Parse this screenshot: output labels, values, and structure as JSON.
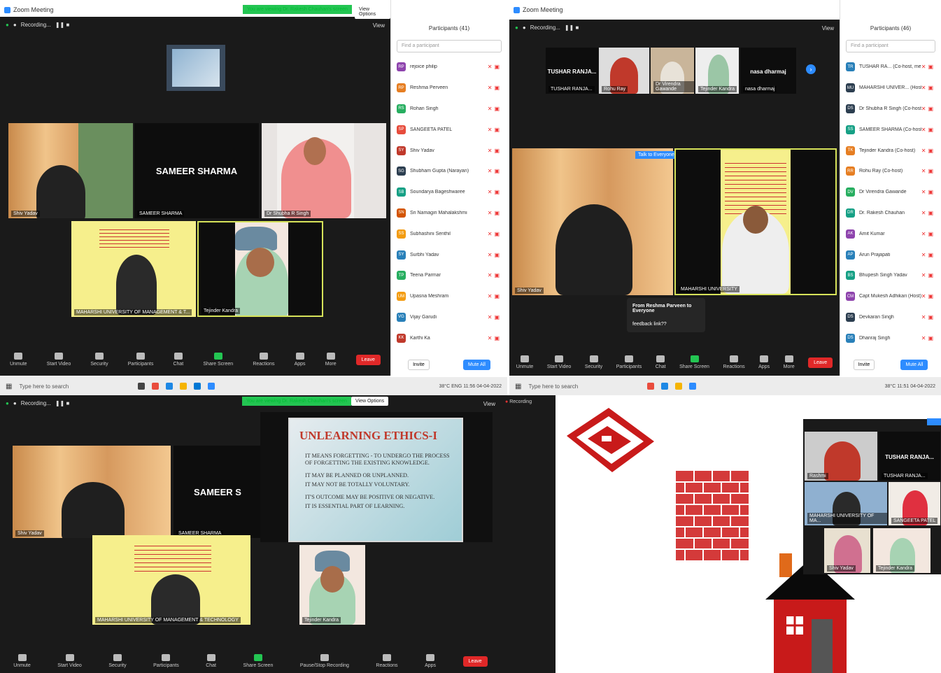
{
  "app": {
    "window_title": "Zoom Meeting",
    "recording_label": "Recording...",
    "view_label": "View"
  },
  "share": {
    "banner_text": "You are viewing Dr. Rakesh Chauhan's screen",
    "view_options": "View Options"
  },
  "q1": {
    "tiles": [
      {
        "name": "Shiv Yadav"
      },
      {
        "name": "SAMEER SHARMA",
        "big": "SAMEER SHARMA"
      },
      {
        "name": "Dr Shubha R Singh"
      },
      {
        "name": "MAHARSHI UNIVERSITY OF MANAGEMENT & T..."
      },
      {
        "name": "Tejinder Kandra"
      }
    ],
    "panel": {
      "title": "Participants (41)",
      "search": "Find a participant",
      "participants": [
        {
          "initials": "RP",
          "name": "rejoice philip",
          "color": "#8e44ad"
        },
        {
          "initials": "RP",
          "name": "Reshma Perveen",
          "color": "#e67e22"
        },
        {
          "initials": "RS",
          "name": "Rohan Singh",
          "color": "#27ae60"
        },
        {
          "initials": "SP",
          "name": "SANGEETA PATEL",
          "color": "#e74c3c"
        },
        {
          "initials": "SY",
          "name": "Shiv Yadav",
          "color": "#c0392b"
        },
        {
          "initials": "SG",
          "name": "Shubham Gupta (Narayan)",
          "color": "#2c3e50"
        },
        {
          "initials": "SB",
          "name": "Soundarya Bageshwaree",
          "color": "#16a085"
        },
        {
          "initials": "SN",
          "name": "Sri Namagiri Mahalakshmi",
          "color": "#d35400"
        },
        {
          "initials": "SS",
          "name": "Subhashini Senthil",
          "color": "#f39c12"
        },
        {
          "initials": "SY",
          "name": "Surbhi Yadav",
          "color": "#2980b9"
        },
        {
          "initials": "TP",
          "name": "Teena Parmar",
          "color": "#27ae60"
        },
        {
          "initials": "UM",
          "name": "Upasna Meshram",
          "color": "#f39c12"
        },
        {
          "initials": "VG",
          "name": "Vijay Garudi",
          "color": "#2980b9"
        },
        {
          "initials": "KK",
          "name": "Karthi Ka",
          "color": "#c0392b"
        }
      ],
      "invite": "Invite",
      "mute_all": "Mute All"
    }
  },
  "q2": {
    "strip": [
      {
        "name": "TUSHAR RANJA...",
        "big": "TUSHAR RANJA..."
      },
      {
        "name": "Rohu Ray"
      },
      {
        "name": "Dr Virendra Gawande"
      },
      {
        "name": "Tejinder Kandra"
      },
      {
        "name": "nasa dharmaj",
        "big": "nasa dharmaj"
      }
    ],
    "main_left": "Shiv Yadav",
    "main_right": "MAHARSHI UNIVERSITY",
    "talk_label": "Talk to Everyone",
    "chat": {
      "from": "From Reshma Parveen to Everyone",
      "msg": "feedback link??"
    },
    "panel": {
      "title": "Participants (46)",
      "search": "Find a participant",
      "participants": [
        {
          "initials": "TR",
          "name": "TUSHAR RA... (Co-host, me)",
          "color": "#2980b9"
        },
        {
          "initials": "MU",
          "name": "MAHARSHI UNIVER... (Host)",
          "color": "#2c3e50"
        },
        {
          "initials": "DS",
          "name": "Dr Shubha R Singh (Co-host)",
          "color": "#2c3e50"
        },
        {
          "initials": "SS",
          "name": "SAMEER SHARMA (Co-host)",
          "color": "#16a085"
        },
        {
          "initials": "TK",
          "name": "Tejinder Kandra (Co-host)",
          "color": "#e67e22"
        },
        {
          "initials": "RR",
          "name": "Rohu Ray (Co-host)",
          "color": "#e67e22"
        },
        {
          "initials": "DV",
          "name": "Dr Virendra Gawande",
          "color": "#27ae60"
        },
        {
          "initials": "DR",
          "name": "Dr. Rakesh Chauhan",
          "color": "#16a085"
        },
        {
          "initials": "AK",
          "name": "Amit Kumar",
          "color": "#8e44ad"
        },
        {
          "initials": "AP",
          "name": "Arun Prajapati",
          "color": "#2980b9"
        },
        {
          "initials": "BS",
          "name": "Bhupesh Singh Yadav",
          "color": "#16a085"
        },
        {
          "initials": "CM",
          "name": "Capt Mukesh Adhikari (Host)",
          "color": "#8e44ad"
        },
        {
          "initials": "DS",
          "name": "Devkaran Singh",
          "color": "#2c3e50"
        },
        {
          "initials": "DS",
          "name": "Dhanraj Singh",
          "color": "#2980b9"
        }
      ],
      "invite": "Invite",
      "mute_all": "Mute All"
    }
  },
  "q3": {
    "tiles": [
      {
        "name": "Shiv Yadav"
      },
      {
        "name": "SAMEER SHARMA",
        "big": "SAMEER S"
      },
      {
        "name": "MAHARSHI UNIVERSITY OF MANAGEMENT & TECHNOLOGY"
      },
      {
        "name": "Tejinder Kandra"
      }
    ],
    "slide": {
      "title": "UNLEARNING ETHICS-I",
      "bullets": [
        "IT MEANS FORGETTING - TO UNDERGO THE PROCESS OF FORGETTING THE EXISTING KNOWLEDGE.",
        "IT MAY BE PLANNED OR UNPLANNED.",
        "IT MAY NOT BE TOTALLY VOLUNTARY.",
        "IT'S OUTCOME MAY BE POSITIVE OR NEGATIVE.",
        "IT IS ESSENTIAL PART OF LEARNING."
      ]
    }
  },
  "q4": {
    "recording": "Recording",
    "gallery": [
      {
        "name": "Rashmi"
      },
      {
        "name": "TUSHAR RANJA...",
        "big": "TUSHAR RANJA..."
      },
      {
        "name": "MAHARSHI UNIVERSITY OF MA..."
      },
      {
        "name": "SANGEETA PATEL"
      },
      {
        "name": "Shiv Yadav"
      },
      {
        "name": "Tejinder Kandra"
      }
    ]
  },
  "toolbar": {
    "items": [
      "Unmute",
      "Start Video",
      "Security",
      "Participants",
      "Chat",
      "Share Screen",
      "Reactions",
      "Apps",
      "More"
    ],
    "q3_items": [
      "Unmute",
      "Start Video",
      "Security",
      "Participants",
      "Chat",
      "Share Screen",
      "Pause/Stop Recording",
      "Reactions",
      "Apps"
    ],
    "leave": "Leave"
  },
  "taskbar": {
    "search": "Type here to search",
    "temp": "38°C",
    "lang": "ENG",
    "time1": "11:56",
    "date1": "04-04-2022",
    "time2": "11:51",
    "date2": "04-04-2022"
  }
}
